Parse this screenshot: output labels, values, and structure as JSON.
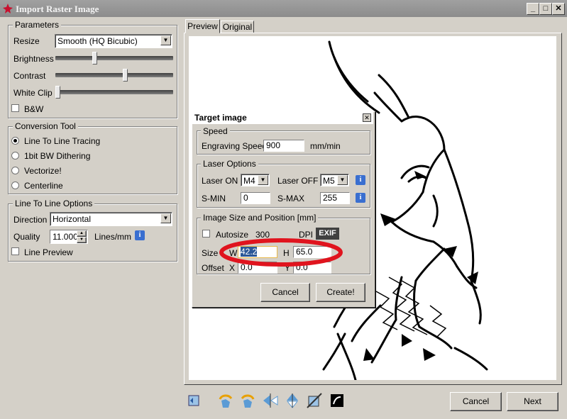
{
  "window": {
    "title": "Import Raster Image"
  },
  "parameters": {
    "group_label": "Parameters",
    "resize_label": "Resize",
    "resize_value": "Smooth (HQ Bicubic)",
    "brightness_label": "Brightness",
    "brightness_level": 0.33,
    "contrast_label": "Contrast",
    "contrast_level": 0.6,
    "white_clip_label": "White Clip",
    "white_clip_level": 0.0,
    "bw_label": "B&W"
  },
  "conversion_tool": {
    "group_label": "Conversion Tool",
    "options": [
      "Line To Line Tracing",
      "1bit BW Dithering",
      "Vectorize!",
      "Centerline"
    ],
    "selected": "Line To Line Tracing"
  },
  "line_options": {
    "group_label": "Line To Line Options",
    "direction_label": "Direction",
    "direction_value": "Horizontal",
    "quality_label": "Quality",
    "quality_value": "11.000",
    "quality_unit": "Lines/mm",
    "line_preview_label": "Line Preview"
  },
  "tabs": [
    "Preview",
    "Original"
  ],
  "dialog": {
    "title": "Target image",
    "speed_group": "Speed",
    "engraving_speed_label": "Engraving Speed",
    "engraving_speed_value": "900",
    "speed_unit": "mm/min",
    "laser_group": "Laser Options",
    "laser_on_label": "Laser ON",
    "laser_on_value": "M4",
    "laser_off_label": "Laser OFF",
    "laser_off_value": "M5",
    "smin_label": "S-MIN",
    "smin_value": "0",
    "smax_label": "S-MAX",
    "smax_value": "255",
    "size_group": "Image Size and Position [mm]",
    "autosize_label": "Autosize",
    "dpi_value": "300",
    "dpi_label": "DPI",
    "exif_label": "EXIF",
    "size_label": "Size",
    "w_label": "W",
    "w_value": "42.2",
    "h_label": "H",
    "h_value": "65.0",
    "offset_label": "Offset",
    "x_label": "X",
    "x_value": "0.0",
    "y_label": "Y",
    "y_value": "0.0",
    "cancel_label": "Cancel",
    "create_label": "Create!"
  },
  "footer": {
    "cancel_label": "Cancel",
    "next_label": "Next"
  },
  "colors": {
    "highlight_circle": "#e0141e",
    "info_blue": "#3a6fd0"
  },
  "icons": [
    "reset-icon",
    "rotate-left-icon",
    "rotate-right-icon",
    "flip-horizontal-icon",
    "flip-vertical-icon",
    "crop-icon",
    "invert-icon"
  ]
}
